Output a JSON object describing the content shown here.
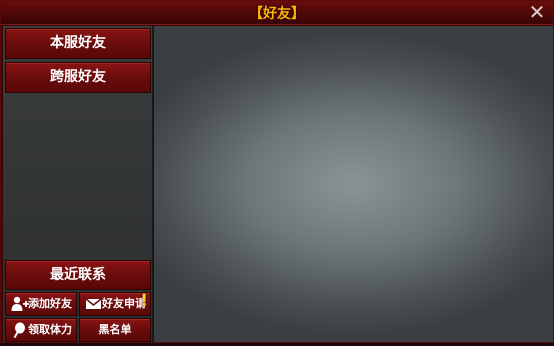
{
  "window": {
    "title": "【好友】"
  },
  "tabs": [
    {
      "label": "本服好友"
    },
    {
      "label": "跨服好友"
    },
    {
      "label": "最近联系"
    }
  ],
  "actions": {
    "add_friend": "添加好友",
    "friend_requests": "好友申请",
    "claim_stamina": "领取体力",
    "blacklist": "黑名单"
  },
  "icons": {
    "close": "close-icon",
    "add_user": "add-user-icon",
    "mail": "mail-icon",
    "alert": "exclamation-icon",
    "stamina": "lollipop-icon"
  },
  "colors": {
    "title": "#ffb400",
    "button": "#7a1010",
    "alert": "#ffd21a"
  }
}
